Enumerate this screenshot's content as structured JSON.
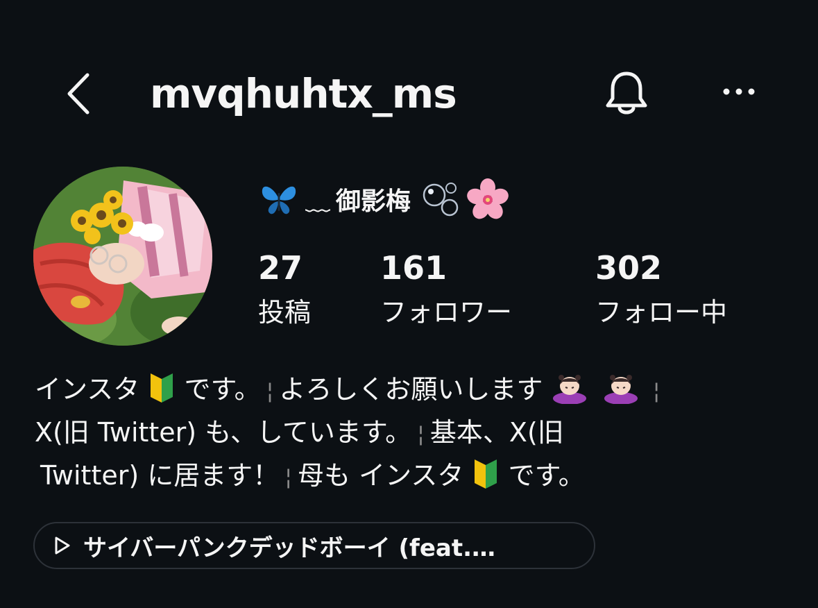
{
  "header": {
    "username": "mvqhuhtx_ms",
    "back_icon": "chevron-left-icon",
    "notification_icon": "bell-icon",
    "more_icon": "ellipsis-icon"
  },
  "profile": {
    "display_name": "御影梅",
    "name_prefix_glyph": "﹏",
    "name_icons": [
      "butterfly-icon",
      "bubbles-icon",
      "cherry-blossom-icon"
    ]
  },
  "stats": {
    "posts": {
      "value": "27",
      "label": "投稿"
    },
    "followers": {
      "value": "161",
      "label": "フォロワー"
    },
    "following": {
      "value": "302",
      "label": "フォロー中"
    }
  },
  "bio": {
    "line1_a": "インスタ",
    "line1_b": "です。",
    "line1_c": "よろしくお願いします",
    "line2_a": "X(旧 Twitter) も、しています。",
    "line2_b": "基本、X(旧",
    "line3_a": "Twitter) に居ます！",
    "line3_b": "母も インスタ",
    "line3_c": "です。",
    "separator": "¦"
  },
  "music": {
    "icon": "play-icon",
    "title": "サイバーパンクデッドボーイ (feat.…"
  },
  "colors": {
    "background": "#0c1014",
    "text": "#f5f5f5",
    "pill_border": "#2d3239",
    "beginner_yellow": "#f2c20d",
    "beginner_green": "#2fa04a"
  }
}
